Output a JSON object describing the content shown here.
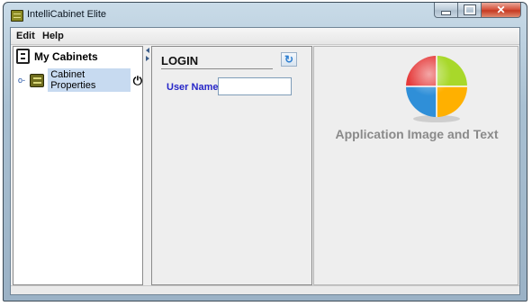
{
  "window": {
    "title": "IntelliCabinet Elite",
    "controls": [
      "minimize",
      "maximize",
      "close"
    ],
    "close_glyph": "✕"
  },
  "menu": {
    "items": [
      {
        "label": "Edit"
      },
      {
        "label": "Help"
      }
    ]
  },
  "tree": {
    "root_label": "My Cabinets",
    "root_icon": "cabinet-icon",
    "expander": "o-",
    "nodes": [
      {
        "label": "Cabinet Properties",
        "icon": "cabinet-node-icon",
        "action_icon": "power-icon",
        "action_glyph": "⏻",
        "selected": true
      }
    ]
  },
  "login": {
    "title": "LOGIN",
    "refresh_glyph": "↻",
    "user_label": "User Name",
    "user_value": ""
  },
  "app_panel": {
    "text": "Application Image and Text",
    "image": "pie-logo-icon",
    "colors": {
      "red": "#e53b3b",
      "green": "#a8d82a",
      "blue": "#2f8fd8",
      "orange": "#ffb000"
    }
  },
  "colors": {
    "title_bar": "#b4c8d8",
    "close_button": "#c63a22",
    "user_label": "#2626c8",
    "selection": "#c7daf0"
  }
}
